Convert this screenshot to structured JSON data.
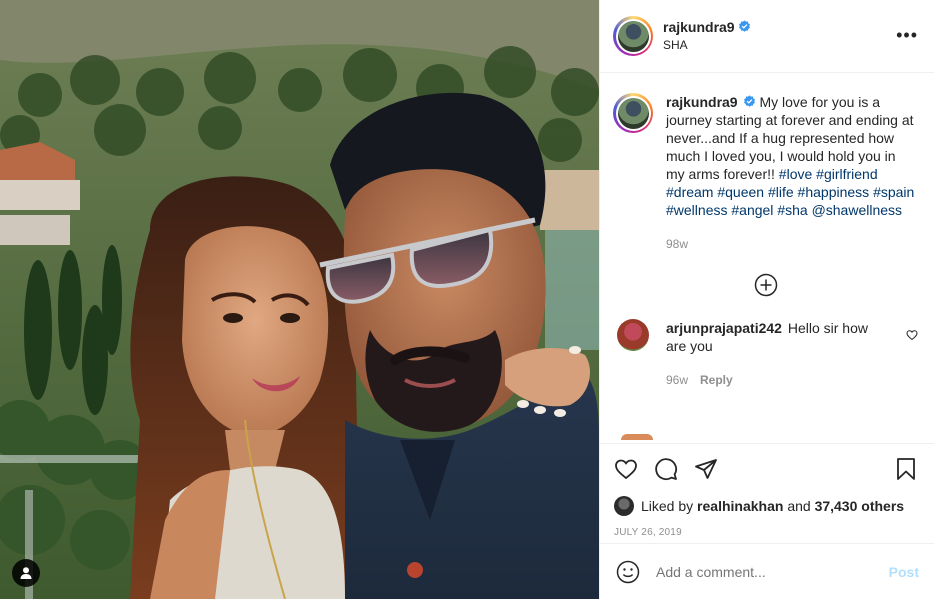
{
  "post": {
    "author": "rajkundra9",
    "location": "SHA",
    "verified": true
  },
  "caption": {
    "username": "rajkundra9",
    "text": "My love for you is a journey starting at forever and ending at never...and If a hug represented how much I loved you, I would hold you in my arms forever!!",
    "tags": [
      "#love",
      "#girlfriend",
      "#dream",
      "#queen",
      "#life",
      "#happiness",
      "#spain",
      "#wellness",
      "#angel",
      "#sha",
      "@shawellness"
    ],
    "age": "98w"
  },
  "comments": [
    {
      "username": "arjunprajapati242",
      "text": "Hello sir how are you",
      "age": "96w",
      "reply_label": "Reply"
    }
  ],
  "likes": {
    "prefix": "Liked by",
    "user": "realhinakhan",
    "joiner": "and",
    "others": "37,430 others"
  },
  "date": "JULY 26, 2019",
  "add_comment": {
    "placeholder": "Add a comment...",
    "post_label": "Post"
  },
  "icons": {
    "verified": "verified-badge-icon",
    "more": "more-options-icon",
    "load_more": "load-more-comments-icon",
    "like": "heart-icon",
    "comment": "comment-bubble-icon",
    "share": "paper-plane-icon",
    "save": "bookmark-icon",
    "emoji": "smiley-icon",
    "tagged": "user-tag-icon"
  },
  "colors": {
    "link": "#00376b",
    "verified": "#3897f0",
    "muted": "#8e8e8e",
    "post_disabled": "#b2dffc"
  }
}
